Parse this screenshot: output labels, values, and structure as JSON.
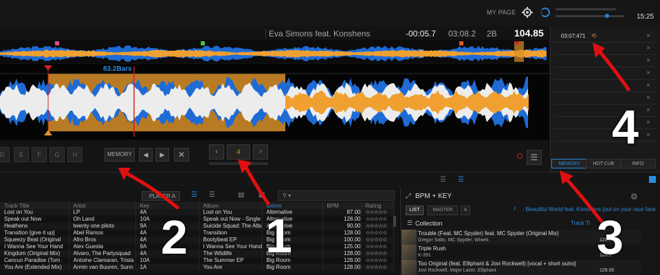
{
  "topbar": {
    "my_page": "MY PAGE",
    "clock": "15:25"
  },
  "deck": {
    "artist_title": "Eva Simons feat. Konshens",
    "remaining": "-00:05.7",
    "elapsed": "03:08.2",
    "beats": "2B",
    "bpm": "104.85",
    "loop_label": "83.2Bars",
    "pads": [
      "D",
      "E",
      "F",
      "G",
      "H"
    ],
    "memory_button": "MEMORY",
    "loop_value": "4"
  },
  "right_panel": {
    "cue_time": "03:07:471",
    "tabs": [
      "MEMORY",
      "HOT CUE",
      "INFO"
    ]
  },
  "browser": {
    "player_select": "PLAYER A",
    "columns": [
      "Track Title",
      "Artist",
      "Key",
      "Album",
      "Genre",
      "BPM",
      "Rating"
    ],
    "rows": [
      [
        "Lost on You",
        "LP",
        "4A",
        "Lost on You",
        "Alternative",
        "87.00"
      ],
      [
        "Speak out Now",
        "Oh Land",
        "10A",
        "Speak out Now - Single",
        "Alternative",
        "128.00"
      ],
      [
        "Heathens",
        "twenty one pilots",
        "9A",
        "Suicide Squad: The Albu",
        "Alternative",
        "90.00"
      ],
      [
        "Transition [give it up]",
        "Abel Ramos",
        "4A",
        "Transition",
        "Big Room",
        "128.00"
      ],
      [
        "Squeezy Beat (Original",
        "Afro Bros",
        "4A",
        "Bootybeat EP",
        "Big Room",
        "100.00"
      ],
      [
        "I Wanna See Your Hand",
        "Alex Guesta",
        "9A",
        "I Wanna See Your Hand",
        "Big Room",
        "125.00"
      ],
      [
        "Kingdom (Original Mix)",
        "Alvaro, The Partysquad",
        "4A",
        "The Wildlife",
        "Big Room",
        "128.00"
      ],
      [
        "Cancun Paradise (Tom",
        "Antoine Clamaran, Trista",
        "10A",
        "The Summer EP",
        "Big Room",
        "128.00"
      ],
      [
        "You Are (Extended Mix)",
        "Armin van Buuren, Sunn",
        "1A",
        "You Are",
        "Big Room",
        "128.00"
      ]
    ]
  },
  "related": {
    "header": "BPM + KEY",
    "list_btn": "LIST",
    "master_btn": "MASTER",
    "a_btn": "A",
    "now_playing": ": Beautiful World feat. Konshens [out on your race face",
    "collection": "Collection",
    "track_title_col": "Track Ti",
    "tracks": [
      {
        "title": "Trouble (Feat. MC Spyder) feat. MC Spyder (Original Mix)",
        "artist": "Gregor Salto, MC Spyder, Wiwek",
        "bpm": "128.0"
      },
      {
        "title": "Triple Rush",
        "artist": "K-391",
        "bpm": "128.0"
      },
      {
        "title": "Too Original (feat. Elliphant & Jovi Rockwell) [vocal + short outro]",
        "artist": "Jovi Rockwell, Major Lazer, Elliphant",
        "bpm": "128.00"
      }
    ]
  },
  "annotations": [
    "1",
    "2",
    "3",
    "4"
  ],
  "colors": {
    "accent": "#2a8be0",
    "loop": "#d8902a",
    "arrow": "#e01010",
    "wave_blue": "#1e6bd6",
    "wave_orange": "#f0a030"
  }
}
